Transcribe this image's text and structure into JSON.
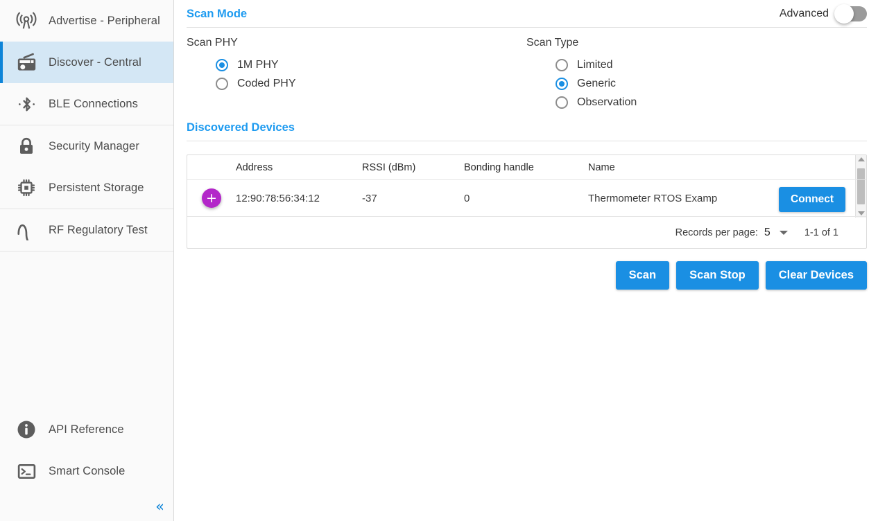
{
  "sidebar": {
    "groups": [
      {
        "items": [
          {
            "label": "Advertise - Peripheral",
            "icon": "antenna-broadcast-icon",
            "active": false
          },
          {
            "label": "Discover - Central",
            "icon": "radio-receiver-icon",
            "active": true
          },
          {
            "label": "BLE Connections",
            "icon": "bluetooth-icon",
            "active": false
          }
        ]
      },
      {
        "items": [
          {
            "label": "Security Manager",
            "icon": "padlock-icon",
            "active": false
          },
          {
            "label": "Persistent Storage",
            "icon": "chip-icon",
            "active": false
          }
        ]
      },
      {
        "items": [
          {
            "label": "RF Regulatory Test",
            "icon": "sine-wave-icon",
            "active": false
          }
        ]
      }
    ],
    "bottom_items": [
      {
        "label": "API Reference",
        "icon": "info-circle-icon"
      },
      {
        "label": "Smart Console",
        "icon": "terminal-icon"
      }
    ],
    "collapse_glyph": "«"
  },
  "main": {
    "scan_mode_title": "Scan Mode",
    "advanced_label": "Advanced",
    "advanced_on": false,
    "scan_phy": {
      "label": "Scan PHY",
      "options": [
        {
          "label": "1M PHY",
          "selected": true
        },
        {
          "label": "Coded PHY",
          "selected": false
        }
      ]
    },
    "scan_type": {
      "label": "Scan Type",
      "options": [
        {
          "label": "Limited",
          "selected": false
        },
        {
          "label": "Generic",
          "selected": true
        },
        {
          "label": "Observation",
          "selected": false
        }
      ]
    },
    "discovered_title": "Discovered Devices",
    "table": {
      "columns": [
        "Address",
        "RSSI (dBm)",
        "Bonding handle",
        "Name"
      ],
      "rows": [
        {
          "add_glyph": "+",
          "address": "12:90:78:56:34:12",
          "rssi": "-37",
          "bonding_handle": "0",
          "name": "Thermometer RTOS Examp",
          "action_label": "Connect"
        }
      ],
      "footer": {
        "records_per_page_label": "Records per page:",
        "records_per_page_value": "5",
        "range": "1-1 of 1"
      }
    },
    "actions": [
      {
        "label": "Scan"
      },
      {
        "label": "Scan Stop"
      },
      {
        "label": "Clear Devices"
      }
    ]
  },
  "colors": {
    "accent_blue": "#1e9bf0",
    "button_blue": "#1a8fe3",
    "active_nav_bg": "#d4e7f5",
    "active_nav_bar": "#0d84d8",
    "fab_purple": "#b327c9",
    "icon_gray": "#5d5d5d"
  }
}
